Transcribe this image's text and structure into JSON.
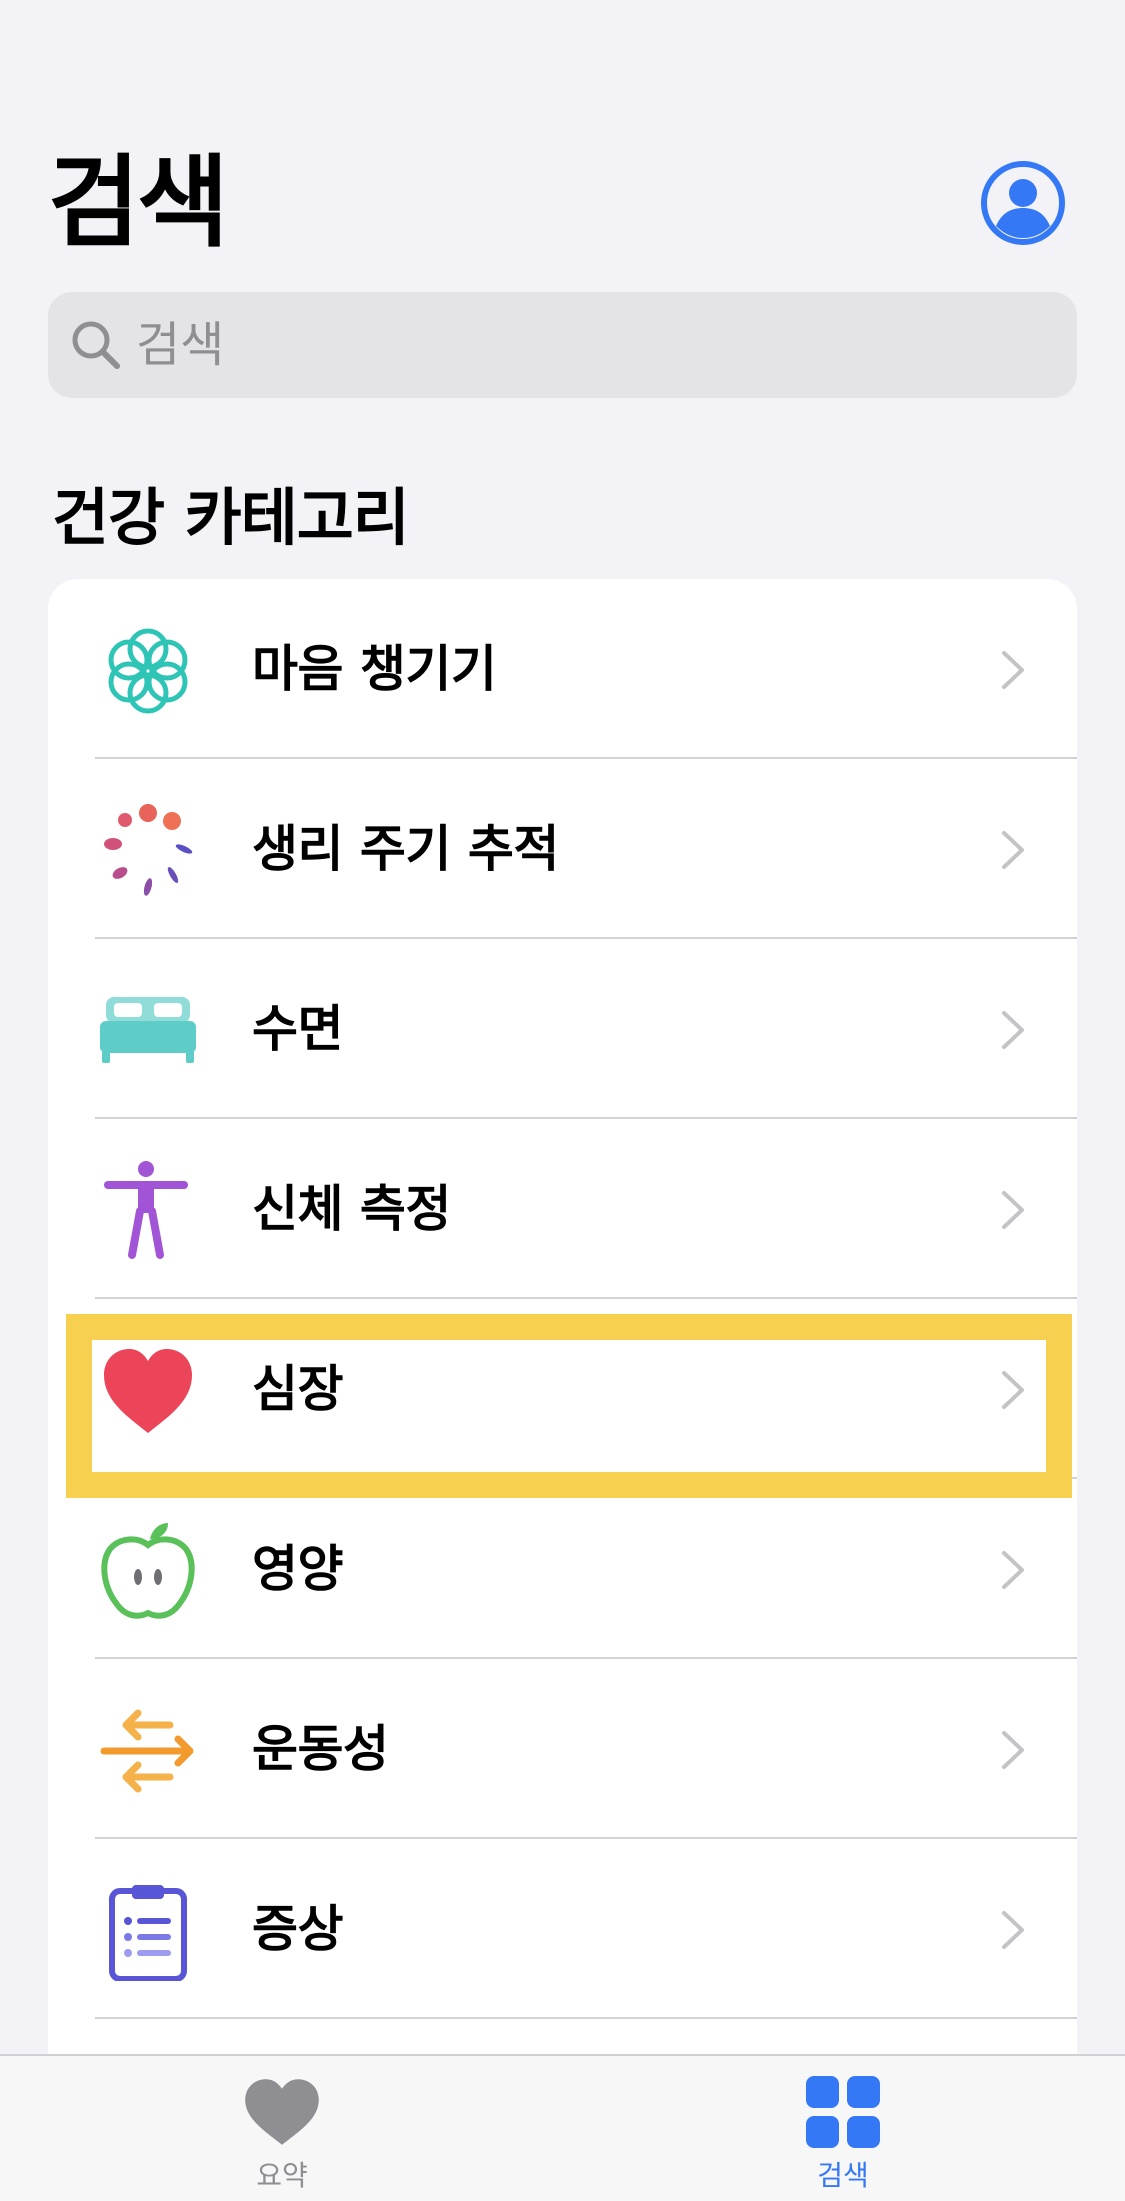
{
  "header": {
    "title": "검색"
  },
  "search": {
    "placeholder": "검색"
  },
  "section": {
    "title": "건강 카테고리"
  },
  "categories": [
    {
      "label": "마음 챙기기",
      "icon": "mindfulness-icon",
      "color": "#2ec4b6"
    },
    {
      "label": "생리 주기 추적",
      "icon": "cycle-tracking-icon",
      "color": "#e8635a"
    },
    {
      "label": "수면",
      "icon": "bed-icon",
      "color": "#5ecdc8"
    },
    {
      "label": "신체 측정",
      "icon": "body-figure-icon",
      "color": "#a254d6"
    },
    {
      "label": "심장",
      "icon": "heart-icon",
      "color": "#ec4459"
    },
    {
      "label": "영양",
      "icon": "apple-icon",
      "color": "#5ac15a"
    },
    {
      "label": "운동성",
      "icon": "mobility-arrows-icon",
      "color": "#f29a2e"
    },
    {
      "label": "증상",
      "icon": "clipboard-icon",
      "color": "#5856d6"
    }
  ],
  "tabbar": {
    "summary_label": "요약",
    "browse_label": "검색",
    "active_color": "#3478f6",
    "inactive_color": "#8e8e93"
  },
  "highlight": {
    "target": "심장",
    "color": "#f8d04f"
  }
}
